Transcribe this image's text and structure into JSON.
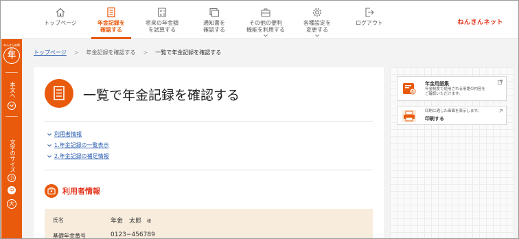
{
  "nav": {
    "items": [
      {
        "line1": "トップページ",
        "line2": "",
        "icon": "home-icon"
      },
      {
        "line1": "年金記録を",
        "line2": "確認する",
        "icon": "document-list-icon",
        "active": true
      },
      {
        "line1": "将来の年金額",
        "line2": "を試算する",
        "icon": "calculator-icon"
      },
      {
        "line1": "通知書を",
        "line2": "確認する",
        "icon": "notice-icon"
      },
      {
        "line1": "その他の便利",
        "line2": "機能を利用する",
        "icon": "toolbox-icon"
      },
      {
        "line1": "各種設定を",
        "line2": "変更する",
        "icon": "gear-icon"
      },
      {
        "line1": "ログアウト",
        "line2": "",
        "icon": "logout-icon"
      }
    ],
    "brand": "ねんきんネット"
  },
  "rail": {
    "logo_text": "ねんきん定期便",
    "logo_glyph": "年",
    "body_text_label": "本文へ",
    "font_size_label": "文字のサイズ",
    "size_small": "小",
    "size_medium": "中",
    "size_large": "大"
  },
  "breadcrumb": {
    "items": [
      "トップページ",
      "年金記録を確認する",
      "一覧で年金記録を確認する"
    ]
  },
  "main": {
    "title": "一覧で年金記録を確認する",
    "toc": [
      "利用者情報",
      "1.年金記録の一覧表示",
      "2.年金記録の補足情報"
    ],
    "section_title": "利用者情報",
    "info": {
      "name_label": "氏名",
      "name_value": "年金　太郎",
      "name_suffix": "様",
      "number_label": "基礎年金番号",
      "number_value": "0123−456789"
    }
  },
  "side": {
    "glossary_title": "年金用語集",
    "glossary_desc_1": "年金制度で使用される用語の内容を",
    "glossary_desc_2": "ご確認いただけます。",
    "print_desc": "印刷に適した画面を表示します。",
    "print_title": "印刷する"
  },
  "colors": {
    "accent": "#e95a0c",
    "brand": "#e4341c",
    "link": "#2a5db0",
    "info_bg": "#f8ecdd"
  }
}
